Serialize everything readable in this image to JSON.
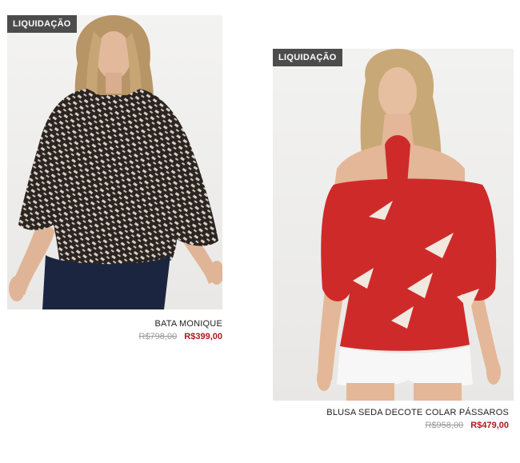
{
  "products": [
    {
      "badge": "LIQUIDAÇÃO",
      "name": "BATA MONIQUE",
      "old_price": "R$798,00",
      "new_price": "R$399,00",
      "image_description": "model wearing black and white printed blouse with jeans"
    },
    {
      "badge": "LIQUIDAÇÃO",
      "name": "BLUSA SEDA DECOTE COLAR PÁSSAROS",
      "old_price": "R$958,00",
      "new_price": "R$479,00",
      "image_description": "model wearing red silk blouse with bird print and white shorts"
    }
  ],
  "colors": {
    "badge_bg": "#4c4c4c",
    "sale_price": "#b0171c",
    "old_price": "#9a9a9a"
  }
}
